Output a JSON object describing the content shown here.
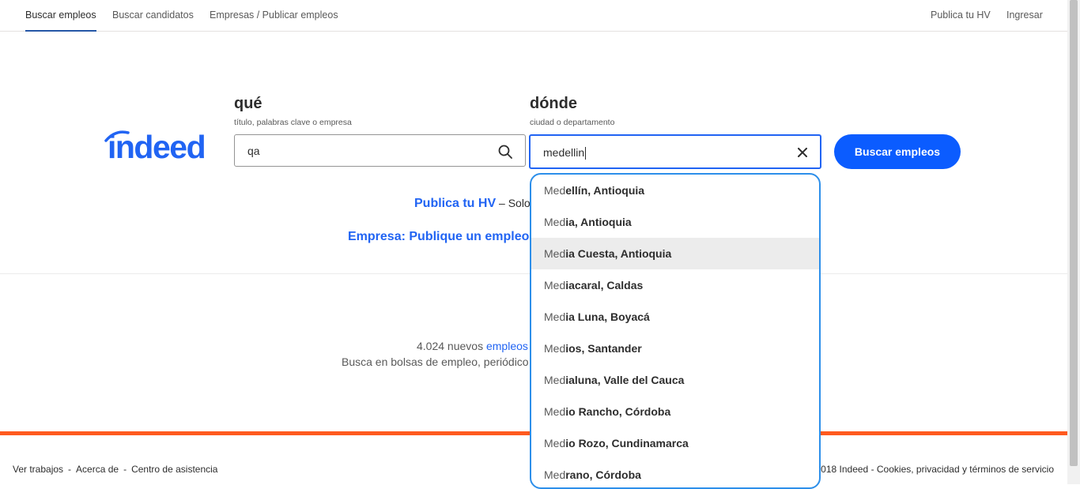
{
  "nav": {
    "left": [
      "Buscar empleos",
      "Buscar candidatos",
      "Empresas / Publicar empleos"
    ],
    "right": [
      "Publica tu HV",
      "Ingresar"
    ]
  },
  "logo": {
    "text": "indeed"
  },
  "what": {
    "title": "qué",
    "subtitle": "título, palabras clave o empresa",
    "value": "qa"
  },
  "where": {
    "title": "dónde",
    "subtitle": "ciudad o departamento",
    "value": "medellin"
  },
  "search_button": "Buscar empleos",
  "promo": {
    "hv_link": "Publica tu HV",
    "hv_rest": " – Solo",
    "employer_link": "Empresa: Publique un empleo"
  },
  "stats": {
    "line1_prefix": "4.024 nuevos ",
    "line1_link": "empleos",
    "line2": "Busca en bolsas de empleo, periódico"
  },
  "footer": {
    "left": [
      "Ver trabajos",
      "Acerca de",
      "Centro de asistencia"
    ],
    "right": "018 Indeed - Cookies, privacidad y términos de servicio"
  },
  "suggestions": [
    {
      "pre": "Med",
      "rest": "ellín, Antioquia"
    },
    {
      "pre": "Med",
      "rest": "ia, Antioquia"
    },
    {
      "pre": "Med",
      "rest": "ia Cuesta, Antioquia"
    },
    {
      "pre": "Med",
      "rest": "iacaral, Caldas"
    },
    {
      "pre": "Med",
      "rest": "ia Luna, Boyacá"
    },
    {
      "pre": "Med",
      "rest": "ios, Santander"
    },
    {
      "pre": "Med",
      "rest": "ialuna, Valle del Cauca"
    },
    {
      "pre": "Med",
      "rest": "io Rancho, Córdoba"
    },
    {
      "pre": "Med",
      "rest": "io Rozo, Cundinamarca"
    },
    {
      "pre": "Med",
      "rest": "rano, Córdoba"
    }
  ],
  "highlighted_index": 2,
  "colors": {
    "brand_blue": "#2164f3",
    "button_blue": "#0b5cff",
    "footer_orange": "#ff5a1f",
    "focus_blue": "#2d8fea"
  }
}
